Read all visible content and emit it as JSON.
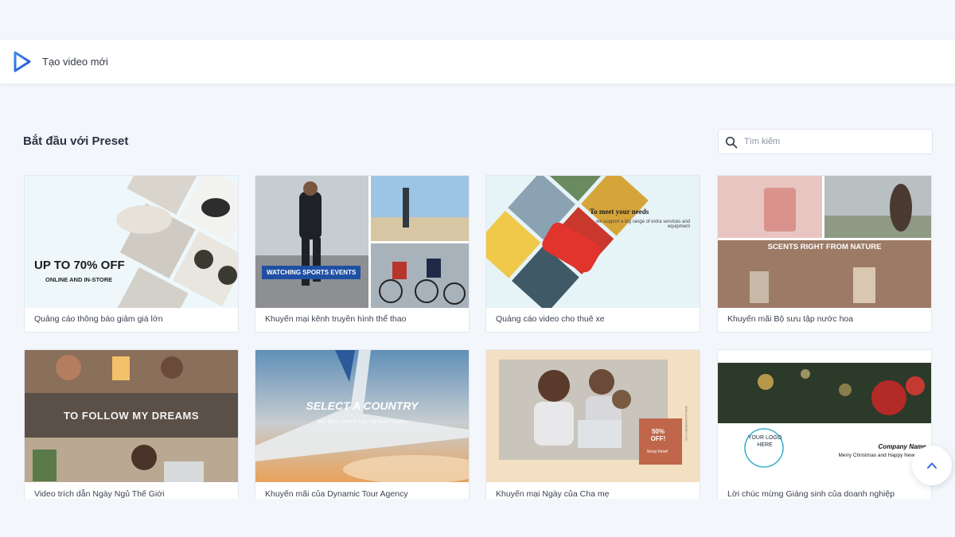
{
  "topbar": {
    "title": "Tạo video mới"
  },
  "section": {
    "title": "Bắt đầu với Preset"
  },
  "search": {
    "placeholder": "Tìm kiếm"
  },
  "cards": [
    {
      "label": "Quảng cáo thông báo giảm giá lớn",
      "thumb_text": [
        "UP TO 70% OFF",
        "ONLINE AND IN-STORE"
      ]
    },
    {
      "label": "Khuyến mại kênh truyền hình thể thao",
      "thumb_text": [
        "WATCHING SPORTS EVENTS"
      ]
    },
    {
      "label": "Quảng cáo video cho thuê xe",
      "thumb_text": [
        "To meet your needs",
        "we support a big range of extra services and equipment"
      ]
    },
    {
      "label": "Khuyến mãi Bộ sưu tập nước hoa",
      "thumb_text": [
        "SCENTS RIGHT FROM NATURE"
      ]
    },
    {
      "label": "Video trích dẫn Ngày Ngủ Thế Giới",
      "thumb_text": [
        "TO FOLLOW MY DREAMS"
      ]
    },
    {
      "label": "Khuyến mãi của Dynamic Tour Agency",
      "thumb_text": [
        "SELECT A COUNTRY",
        "AND WE'LL OFFER YOU THE BEST TOURS!"
      ]
    },
    {
      "label": "Khuyến mại Ngày của Cha mẹ",
      "thumb_text": [
        "50% OFF!",
        "Shop Now!"
      ]
    },
    {
      "label": "Lời chúc mừng Giáng sinh của doanh nghiệp",
      "thumb_text": [
        "YOUR LOGO HERE",
        "Company Name",
        "Merry Christmas and Happy New Year"
      ]
    }
  ],
  "colors": {
    "accent": "#2f6fe0",
    "page_bg": "#f3f6fb"
  },
  "icons": {
    "logo": "play-logo-icon",
    "search": "search-icon",
    "scroll_top": "chevron-up-icon"
  }
}
